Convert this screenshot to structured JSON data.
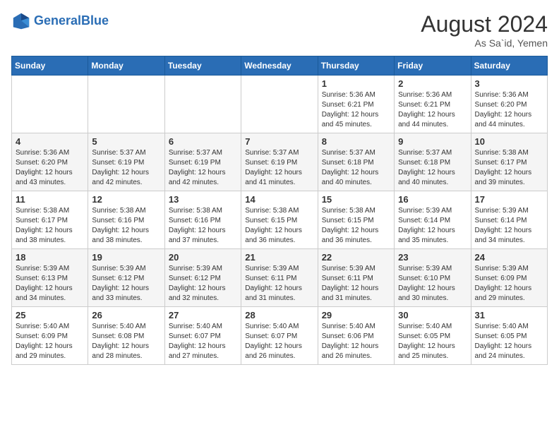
{
  "header": {
    "logo_general": "General",
    "logo_blue": "Blue",
    "month_title": "August 2024",
    "location": "As Sa`id, Yemen"
  },
  "days_of_week": [
    "Sunday",
    "Monday",
    "Tuesday",
    "Wednesday",
    "Thursday",
    "Friday",
    "Saturday"
  ],
  "weeks": [
    [
      {
        "day": "",
        "sunrise": "",
        "sunset": "",
        "daylight": ""
      },
      {
        "day": "",
        "sunrise": "",
        "sunset": "",
        "daylight": ""
      },
      {
        "day": "",
        "sunrise": "",
        "sunset": "",
        "daylight": ""
      },
      {
        "day": "",
        "sunrise": "",
        "sunset": "",
        "daylight": ""
      },
      {
        "day": "1",
        "sunrise": "Sunrise: 5:36 AM",
        "sunset": "Sunset: 6:21 PM",
        "daylight": "Daylight: 12 hours and 45 minutes."
      },
      {
        "day": "2",
        "sunrise": "Sunrise: 5:36 AM",
        "sunset": "Sunset: 6:21 PM",
        "daylight": "Daylight: 12 hours and 44 minutes."
      },
      {
        "day": "3",
        "sunrise": "Sunrise: 5:36 AM",
        "sunset": "Sunset: 6:20 PM",
        "daylight": "Daylight: 12 hours and 44 minutes."
      }
    ],
    [
      {
        "day": "4",
        "sunrise": "Sunrise: 5:36 AM",
        "sunset": "Sunset: 6:20 PM",
        "daylight": "Daylight: 12 hours and 43 minutes."
      },
      {
        "day": "5",
        "sunrise": "Sunrise: 5:37 AM",
        "sunset": "Sunset: 6:19 PM",
        "daylight": "Daylight: 12 hours and 42 minutes."
      },
      {
        "day": "6",
        "sunrise": "Sunrise: 5:37 AM",
        "sunset": "Sunset: 6:19 PM",
        "daylight": "Daylight: 12 hours and 42 minutes."
      },
      {
        "day": "7",
        "sunrise": "Sunrise: 5:37 AM",
        "sunset": "Sunset: 6:19 PM",
        "daylight": "Daylight: 12 hours and 41 minutes."
      },
      {
        "day": "8",
        "sunrise": "Sunrise: 5:37 AM",
        "sunset": "Sunset: 6:18 PM",
        "daylight": "Daylight: 12 hours and 40 minutes."
      },
      {
        "day": "9",
        "sunrise": "Sunrise: 5:37 AM",
        "sunset": "Sunset: 6:18 PM",
        "daylight": "Daylight: 12 hours and 40 minutes."
      },
      {
        "day": "10",
        "sunrise": "Sunrise: 5:38 AM",
        "sunset": "Sunset: 6:17 PM",
        "daylight": "Daylight: 12 hours and 39 minutes."
      }
    ],
    [
      {
        "day": "11",
        "sunrise": "Sunrise: 5:38 AM",
        "sunset": "Sunset: 6:17 PM",
        "daylight": "Daylight: 12 hours and 38 minutes."
      },
      {
        "day": "12",
        "sunrise": "Sunrise: 5:38 AM",
        "sunset": "Sunset: 6:16 PM",
        "daylight": "Daylight: 12 hours and 38 minutes."
      },
      {
        "day": "13",
        "sunrise": "Sunrise: 5:38 AM",
        "sunset": "Sunset: 6:16 PM",
        "daylight": "Daylight: 12 hours and 37 minutes."
      },
      {
        "day": "14",
        "sunrise": "Sunrise: 5:38 AM",
        "sunset": "Sunset: 6:15 PM",
        "daylight": "Daylight: 12 hours and 36 minutes."
      },
      {
        "day": "15",
        "sunrise": "Sunrise: 5:38 AM",
        "sunset": "Sunset: 6:15 PM",
        "daylight": "Daylight: 12 hours and 36 minutes."
      },
      {
        "day": "16",
        "sunrise": "Sunrise: 5:39 AM",
        "sunset": "Sunset: 6:14 PM",
        "daylight": "Daylight: 12 hours and 35 minutes."
      },
      {
        "day": "17",
        "sunrise": "Sunrise: 5:39 AM",
        "sunset": "Sunset: 6:14 PM",
        "daylight": "Daylight: 12 hours and 34 minutes."
      }
    ],
    [
      {
        "day": "18",
        "sunrise": "Sunrise: 5:39 AM",
        "sunset": "Sunset: 6:13 PM",
        "daylight": "Daylight: 12 hours and 34 minutes."
      },
      {
        "day": "19",
        "sunrise": "Sunrise: 5:39 AM",
        "sunset": "Sunset: 6:12 PM",
        "daylight": "Daylight: 12 hours and 33 minutes."
      },
      {
        "day": "20",
        "sunrise": "Sunrise: 5:39 AM",
        "sunset": "Sunset: 6:12 PM",
        "daylight": "Daylight: 12 hours and 32 minutes."
      },
      {
        "day": "21",
        "sunrise": "Sunrise: 5:39 AM",
        "sunset": "Sunset: 6:11 PM",
        "daylight": "Daylight: 12 hours and 31 minutes."
      },
      {
        "day": "22",
        "sunrise": "Sunrise: 5:39 AM",
        "sunset": "Sunset: 6:11 PM",
        "daylight": "Daylight: 12 hours and 31 minutes."
      },
      {
        "day": "23",
        "sunrise": "Sunrise: 5:39 AM",
        "sunset": "Sunset: 6:10 PM",
        "daylight": "Daylight: 12 hours and 30 minutes."
      },
      {
        "day": "24",
        "sunrise": "Sunrise: 5:39 AM",
        "sunset": "Sunset: 6:09 PM",
        "daylight": "Daylight: 12 hours and 29 minutes."
      }
    ],
    [
      {
        "day": "25",
        "sunrise": "Sunrise: 5:40 AM",
        "sunset": "Sunset: 6:09 PM",
        "daylight": "Daylight: 12 hours and 29 minutes."
      },
      {
        "day": "26",
        "sunrise": "Sunrise: 5:40 AM",
        "sunset": "Sunset: 6:08 PM",
        "daylight": "Daylight: 12 hours and 28 minutes."
      },
      {
        "day": "27",
        "sunrise": "Sunrise: 5:40 AM",
        "sunset": "Sunset: 6:07 PM",
        "daylight": "Daylight: 12 hours and 27 minutes."
      },
      {
        "day": "28",
        "sunrise": "Sunrise: 5:40 AM",
        "sunset": "Sunset: 6:07 PM",
        "daylight": "Daylight: 12 hours and 26 minutes."
      },
      {
        "day": "29",
        "sunrise": "Sunrise: 5:40 AM",
        "sunset": "Sunset: 6:06 PM",
        "daylight": "Daylight: 12 hours and 26 minutes."
      },
      {
        "day": "30",
        "sunrise": "Sunrise: 5:40 AM",
        "sunset": "Sunset: 6:05 PM",
        "daylight": "Daylight: 12 hours and 25 minutes."
      },
      {
        "day": "31",
        "sunrise": "Sunrise: 5:40 AM",
        "sunset": "Sunset: 6:05 PM",
        "daylight": "Daylight: 12 hours and 24 minutes."
      }
    ]
  ]
}
